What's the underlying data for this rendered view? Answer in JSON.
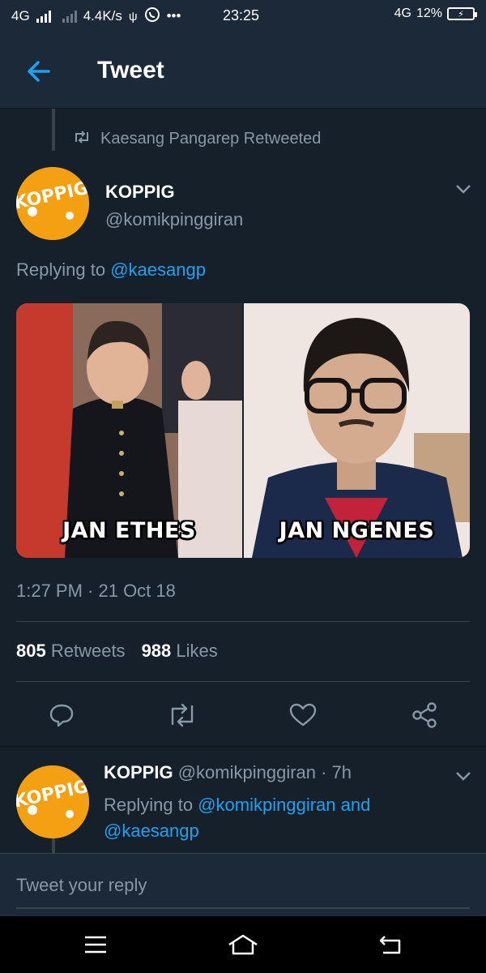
{
  "status_bar": {
    "network_left": "4G",
    "speed": "4.4K/s",
    "time": "23:25",
    "network_right": "4G",
    "battery_percent": "12%"
  },
  "header": {
    "title": "Tweet"
  },
  "tweet": {
    "retweeted_by": "Kaesang Pangarep Retweeted",
    "author_name": "KOPPIG",
    "author_handle": "@komikpinggiran",
    "replying_prefix": "Replying to",
    "replying_to": "@kaesangp",
    "avatar_text": "KOPPIG",
    "media_captions": [
      "JAN ETHES",
      "JAN NGENES"
    ],
    "timestamp": "1:27 PM · 21 Oct 18",
    "retweet_count": "805",
    "retweet_label": "Retweets",
    "like_count": "988",
    "like_label": "Likes"
  },
  "reply": {
    "author_name": "KOPPIG",
    "author_handle_time": "@komikpinggiran · 7h",
    "replying_prefix": "Replying to",
    "replying_to_1": "@komikpinggiran and",
    "replying_to_2": "@kaesangp"
  },
  "compose": {
    "placeholder": "Tweet your reply"
  },
  "colors": {
    "background": "#15202b",
    "header": "#1c2938",
    "accent": "#1da1f2",
    "muted": "#8899a6",
    "avatar": "#f5a011"
  },
  "icons": [
    "back-arrow-icon",
    "retweet-icon",
    "chevron-down-icon",
    "reply-icon",
    "like-icon",
    "share-icon",
    "menu-icon",
    "home-icon",
    "return-icon"
  ]
}
